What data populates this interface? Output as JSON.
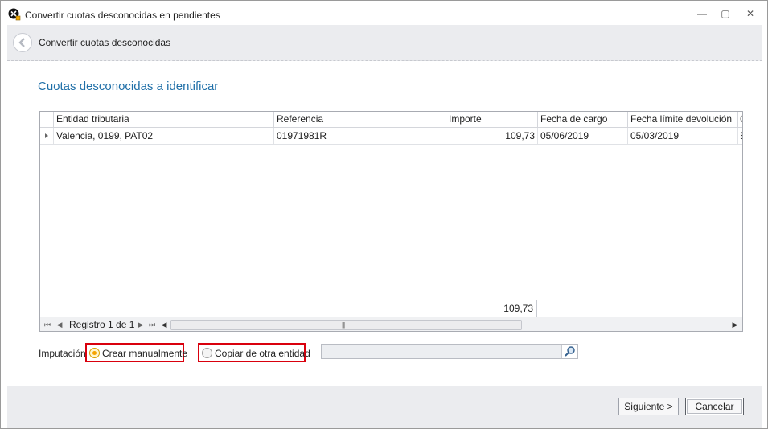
{
  "window": {
    "title": "Convertir cuotas desconocidas en pendientes",
    "controls": {
      "minimize": "—",
      "restore": "▢",
      "close": "✕"
    }
  },
  "header": {
    "title": "Convertir cuotas desconocidas"
  },
  "section": {
    "title": "Cuotas desconocidas a identificar"
  },
  "grid": {
    "columns": [
      "Entidad tributaria",
      "Referencia",
      "Importe",
      "Fecha de cargo",
      "Fecha límite devolución",
      "C"
    ],
    "rows": [
      {
        "entidad": "Valencia, 0199, PAT02",
        "referencia": "01971981R",
        "importe": "109,73",
        "fecha_cargo": "05/06/2019",
        "fecha_limite": "05/03/2019",
        "extra": "B"
      }
    ],
    "total_importe": "109,73",
    "navigator": {
      "record_text": "Registro 1 de 1"
    }
  },
  "imputacion": {
    "label": "Imputación",
    "options": [
      {
        "label": "Crear manualmente",
        "checked": true
      },
      {
        "label": "Copiar de otra entidad",
        "checked": false
      }
    ],
    "lookup_value": ""
  },
  "buttons": {
    "next": "Siguiente >",
    "cancel": "Cancelar"
  },
  "colors": {
    "accent": "#1f6fa8",
    "highlight": "#d9000d"
  },
  "icons": [
    "app-icon",
    "back-arrow-icon",
    "first-record-icon",
    "prev-record-icon",
    "next-record-icon",
    "last-record-icon",
    "scroll-left-icon",
    "scroll-right-icon",
    "search-icon"
  ]
}
